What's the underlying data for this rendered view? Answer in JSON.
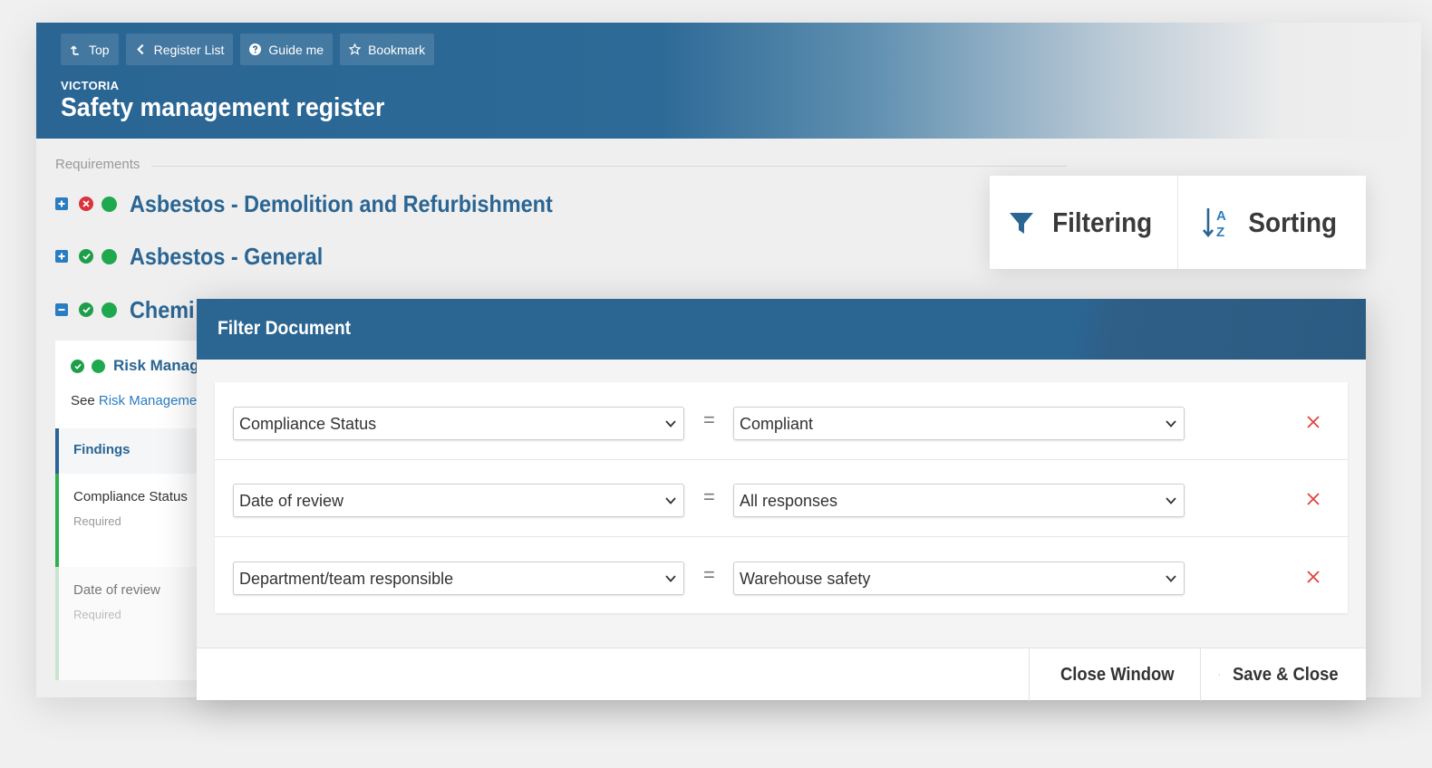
{
  "toolbar": {
    "top_label": "Top",
    "register_list_label": "Register List",
    "guide_label": "Guide me",
    "bookmark_label": "Bookmark"
  },
  "header": {
    "region": "VICTORIA",
    "title": "Safety management register"
  },
  "requirements": {
    "section_label": "Requirements",
    "items": [
      {
        "title": "Asbestos - Demolition and Refurbishment"
      },
      {
        "title": "Asbestos - General"
      },
      {
        "title": "Chemi"
      }
    ]
  },
  "detail": {
    "risk_title": "Risk Manag",
    "see_prefix": "See",
    "see_link": "Risk Manageme",
    "findings_label": "Findings",
    "fields": [
      {
        "name": "Compliance Status",
        "sub": "Required"
      },
      {
        "name": "Date of review",
        "sub": "Required"
      }
    ]
  },
  "tabs": {
    "filtering_label": "Filtering",
    "sorting_label": "Sorting"
  },
  "modal": {
    "title": "Filter Document",
    "rules": [
      {
        "field": "Compliance Status",
        "operator": "=",
        "value": "Compliant"
      },
      {
        "field": "Date of review",
        "operator": "=",
        "value": "All responses"
      },
      {
        "field": "Department/team responsible",
        "operator": "=",
        "value": "Warehouse safety"
      }
    ],
    "close_label": "Close Window",
    "save_label": "Save & Close"
  },
  "colors": {
    "brand_blue": "#2a6593",
    "status_green": "#1fa84d",
    "status_red": "#d9343a"
  }
}
